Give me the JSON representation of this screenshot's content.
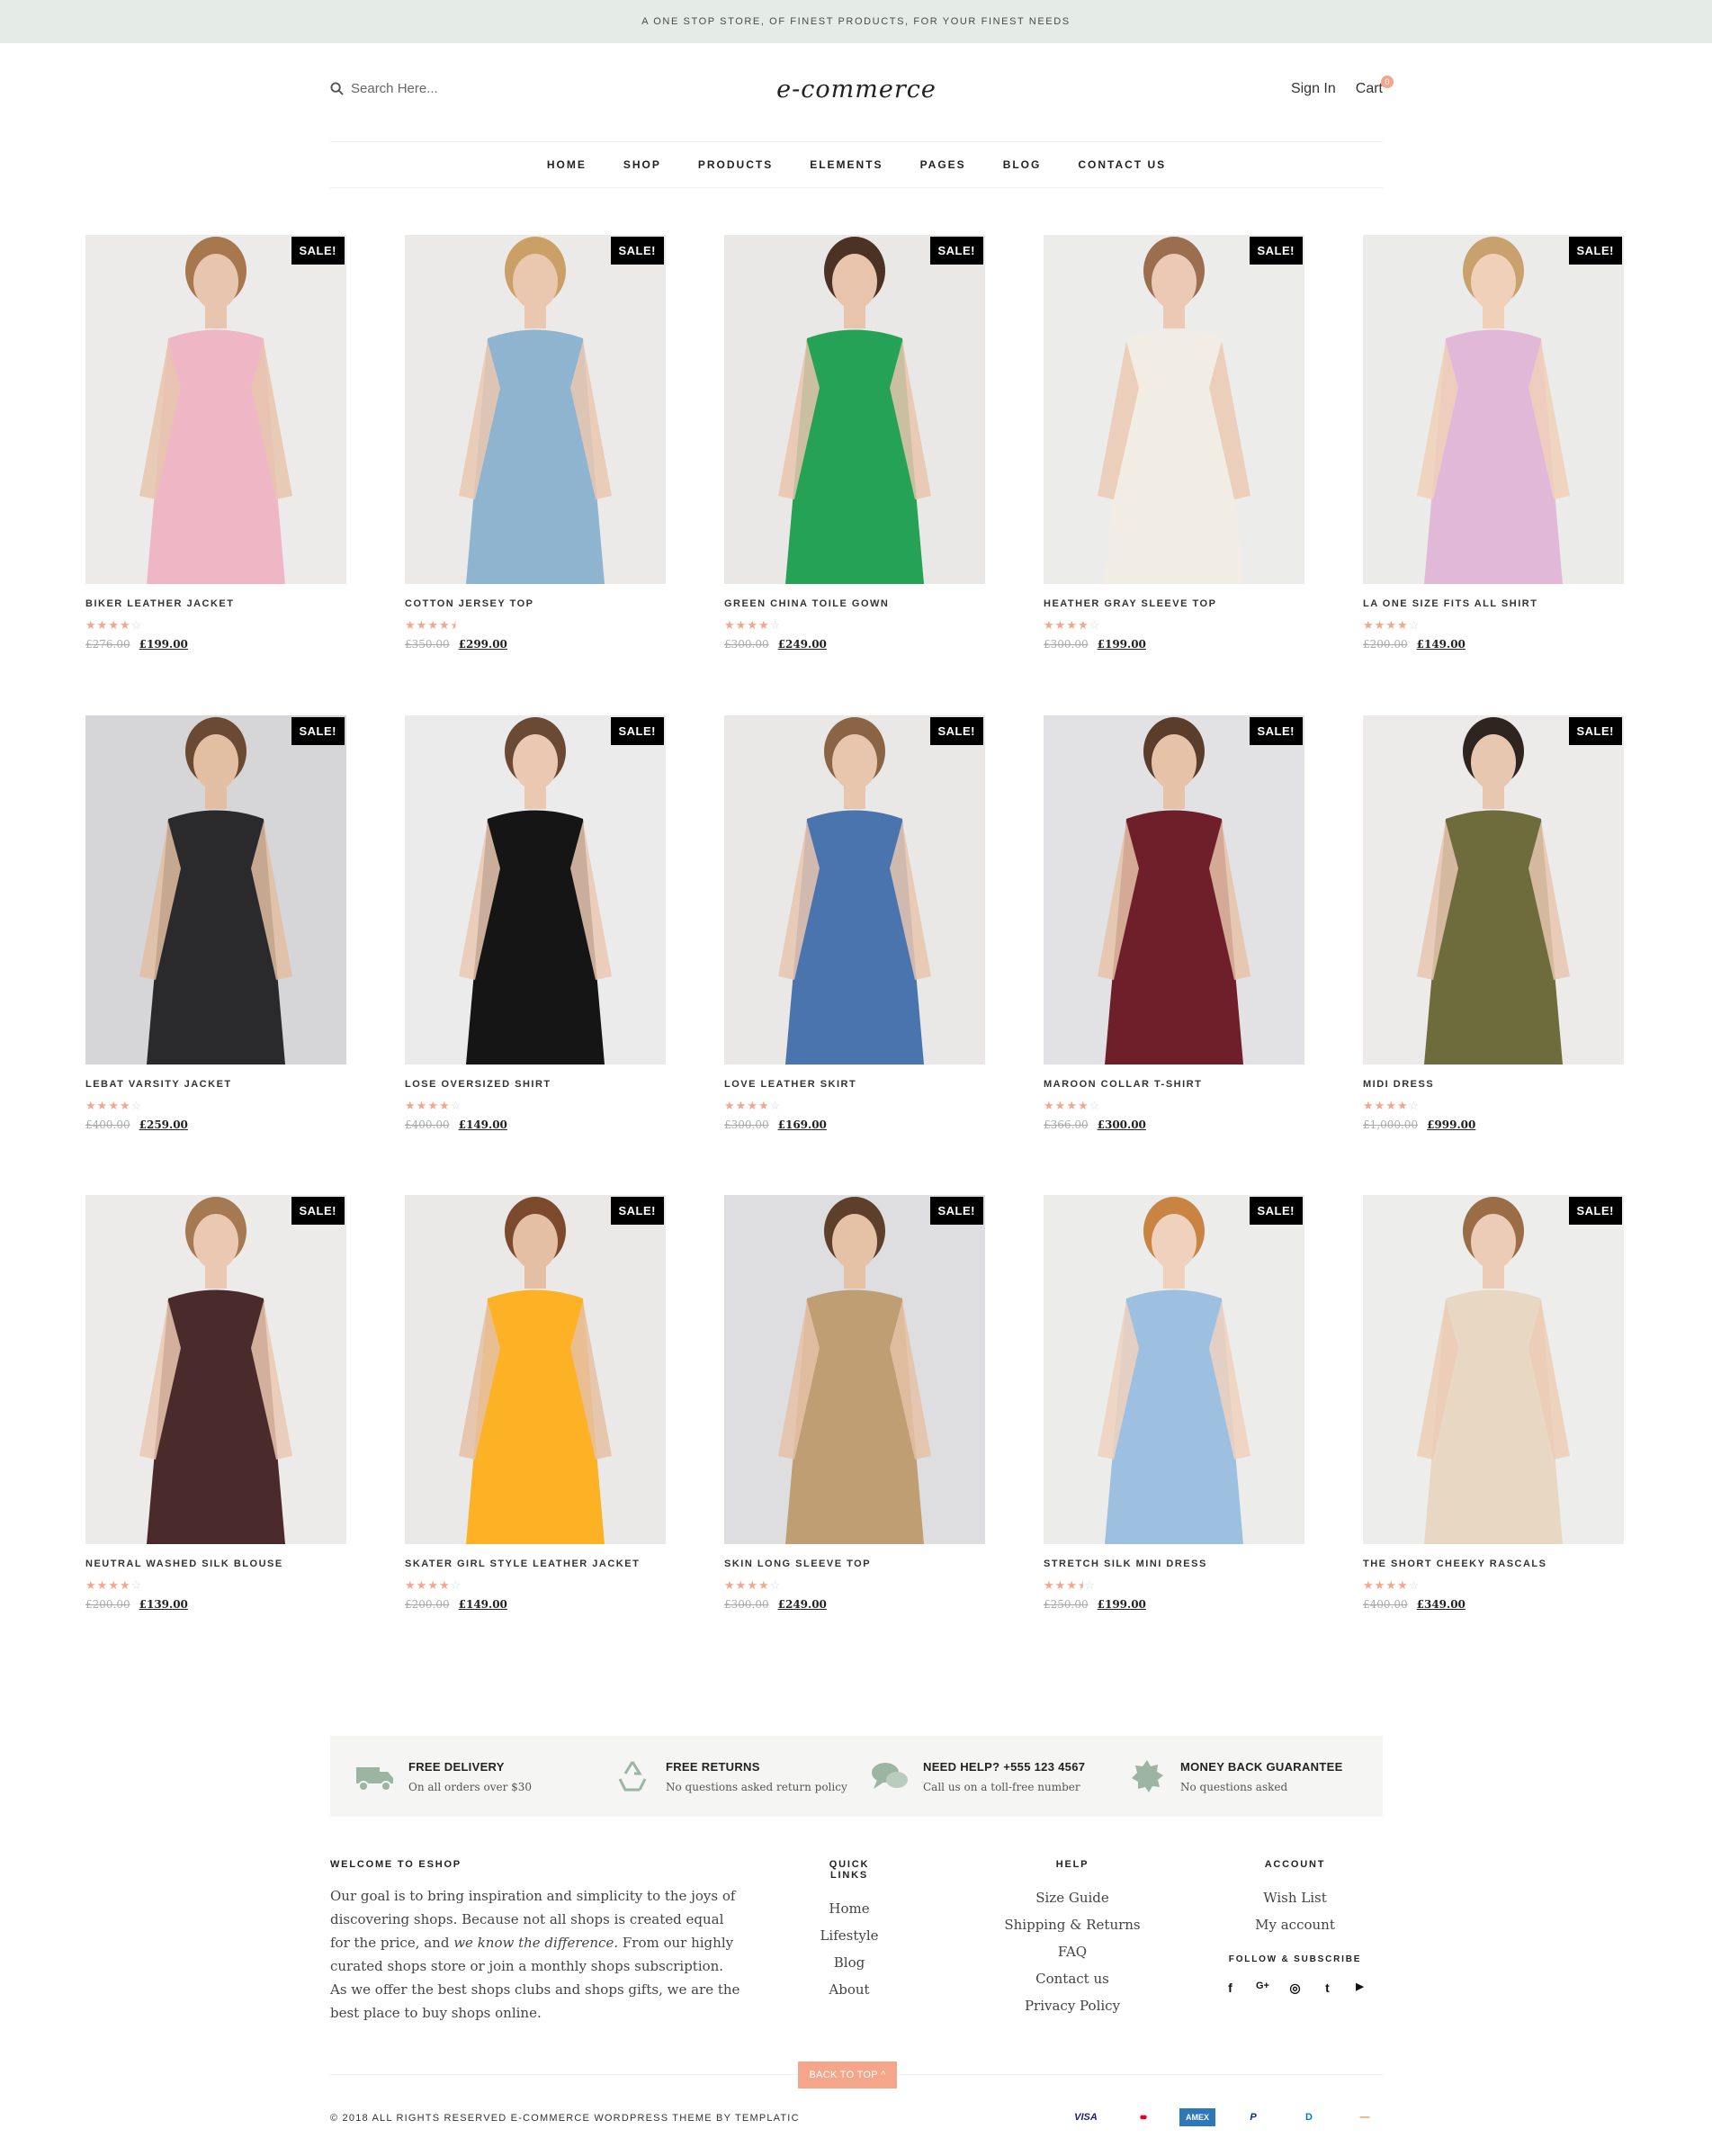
{
  "topbar": {
    "text": "A ONE STOP STORE, OF FINEST PRODUCTS, FOR YOUR FINEST NEEDS"
  },
  "header": {
    "search_placeholder": "Search Here...",
    "logo": "e-commerce",
    "sign_in": "Sign In",
    "cart": "Cart",
    "cart_count": "0"
  },
  "nav": [
    "HOME",
    "SHOP",
    "PRODUCTS",
    "ELEMENTS",
    "PAGES",
    "BLOG",
    "CONTACT US"
  ],
  "sale_label": "SALE!",
  "products": [
    {
      "name": "BIKER LEATHER JACKET",
      "rating": 4,
      "old_price": "£276.00",
      "price": "£199.00",
      "bg": "#ecebea",
      "garment": "#efb7c6",
      "skin": "#e7c5ae",
      "hair": "#a7774d"
    },
    {
      "name": "COTTON JERSEY TOP",
      "rating": 4.5,
      "old_price": "£350.00",
      "price": "£299.00",
      "bg": "#eceae8",
      "garment": "#8fb4cf",
      "skin": "#eac8b0",
      "hair": "#caa066"
    },
    {
      "name": "GREEN CHINA TOILE GOWN",
      "rating": 4,
      "old_price": "£300.00",
      "price": "£249.00",
      "bg": "#e9e8e6",
      "garment": "#25a256",
      "skin": "#e8c4ad",
      "hair": "#4b3224"
    },
    {
      "name": "HEATHER GRAY SLEEVE TOP",
      "rating": 4,
      "old_price": "£300.00",
      "price": "£199.00",
      "bg": "#ececea",
      "garment": "#f2ede4",
      "skin": "#ebc9b4",
      "hair": "#9b6e4f"
    },
    {
      "name": "LA ONE SIZE FITS ALL SHIRT",
      "rating": 4,
      "old_price": "£200.00",
      "price": "£149.00",
      "bg": "#ebebea",
      "garment": "#e2b8d9",
      "skin": "#f0d0b8",
      "hair": "#c8a16d"
    },
    {
      "name": "LEBAT VARSITY JACKET",
      "rating": 4,
      "old_price": "£400.00",
      "price": "£259.00",
      "bg": "#d6d6d8",
      "garment": "#2a2a2c",
      "skin": "#e2bea3",
      "hair": "#6b4a34"
    },
    {
      "name": "LOSE OVERSIZED SHIRT",
      "rating": 4,
      "old_price": "£400.00",
      "price": "£149.00",
      "bg": "#ecebeb",
      "garment": "#151515",
      "skin": "#eac8b2",
      "hair": "#6a4a34"
    },
    {
      "name": "LOVE LEATHER SKIRT",
      "rating": 4,
      "old_price": "£300.00",
      "price": "£169.00",
      "bg": "#e9e8e7",
      "garment": "#4a74ad",
      "skin": "#e8c6ae",
      "hair": "#8a6445"
    },
    {
      "name": "MAROON COLLAR T-SHIRT",
      "rating": 4,
      "old_price": "£366.00",
      "price": "£300.00",
      "bg": "#e2e2e4",
      "garment": "#6e1f2a",
      "skin": "#e6c2a8",
      "hair": "#5b3d2b"
    },
    {
      "name": "MIDI DRESS",
      "rating": 4,
      "old_price": "£1,000.00",
      "price": "£999.00",
      "bg": "#ecebea",
      "garment": "#6e6b3c",
      "skin": "#e8c7b0",
      "hair": "#2e2420"
    },
    {
      "name": "NEUTRAL WASHED SILK BLOUSE",
      "rating": 4,
      "old_price": "£200.00",
      "price": "£139.00",
      "bg": "#ecebea",
      "garment": "#4a2a2a",
      "skin": "#eac8b1",
      "hair": "#a57a52"
    },
    {
      "name": "SKATER GIRL STYLE LEATHER JACKET",
      "rating": 4,
      "old_price": "£200.00",
      "price": "£149.00",
      "bg": "#ebe9e7",
      "garment": "#fdb226",
      "skin": "#e5bfa4",
      "hair": "#7c4a2c"
    },
    {
      "name": "SKIN LONG SLEEVE TOP",
      "rating": 4,
      "old_price": "£300.00",
      "price": "£249.00",
      "bg": "#dedee0",
      "garment": "#bf9e74",
      "skin": "#e5c1a6",
      "hair": "#5d3f2b"
    },
    {
      "name": "STRETCH SILK MINI DRESS",
      "rating": 3.5,
      "old_price": "£250.00",
      "price": "£199.00",
      "bg": "#ececeb",
      "garment": "#9ec0e0",
      "skin": "#efd1bd",
      "hair": "#c98444"
    },
    {
      "name": "THE SHORT CHEEKY RASCALS",
      "rating": 4,
      "old_price": "£400.00",
      "price": "£349.00",
      "bg": "#ededec",
      "garment": "#e8d7c2",
      "skin": "#ecccb6",
      "hair": "#9b6d46"
    }
  ],
  "features": [
    {
      "title": "FREE DELIVERY",
      "subtitle": "On all orders over $30",
      "icon": "truck-icon"
    },
    {
      "title": "FREE RETURNS",
      "subtitle": "No questions asked return policy",
      "icon": "recycle-icon"
    },
    {
      "title": "NEED HELP? +555 123 4567",
      "subtitle": "Call us on a toll-free number",
      "icon": "chat-icon"
    },
    {
      "title": "MONEY BACK GUARANTEE",
      "subtitle": "No questions asked",
      "icon": "badge-icon"
    }
  ],
  "footer": {
    "about_title": "WELCOME TO ESHOP",
    "about_text_1": "Our goal is to bring inspiration and simplicity to the joys of discovering shops. Because not all shops is created equal for the price, and ",
    "about_text_em": "we know the difference.",
    "about_text_2": " From our highly curated shops store or join a monthly shops subscription. As we offer the best shops clubs and shops gifts, we are the best place to buy shops online.",
    "quick_links_title": "QUICK LINKS",
    "quick_links": [
      "Home",
      "Lifestyle",
      "Blog",
      "About"
    ],
    "help_title": "HELP",
    "help_links": [
      "Size Guide",
      "Shipping & Returns",
      "FAQ",
      "Contact us",
      "Privacy Policy"
    ],
    "account_title": "ACCOUNT",
    "account_links": [
      "Wish List",
      "My account"
    ],
    "follow_title": "FOLLOW & SUBSCRIBE",
    "socials": [
      "f",
      "G+",
      "◎",
      "t",
      "▶"
    ],
    "social_icons": [
      "facebook-icon",
      "google-plus-icon",
      "instagram-icon",
      "twitter-icon",
      "youtube-icon"
    ]
  },
  "bottom": {
    "back_to_top": "BACK TO TOP ^",
    "copyright": "© 2018 ALL RIGHTS RESERVED E-COMMERCE WORDPRESS THEME BY TEMPLATIC",
    "payments": [
      "VISA",
      "●●",
      "AMEX",
      "P",
      "D",
      "—"
    ],
    "payment_icons": [
      "visa-icon",
      "mastercard-icon",
      "amex-icon",
      "paypal-icon",
      "diners-icon",
      "discover-icon"
    ]
  },
  "colors": {
    "accent": "#f4a58a",
    "topbar": "#e5ebe6",
    "star": "#f2a78c"
  }
}
